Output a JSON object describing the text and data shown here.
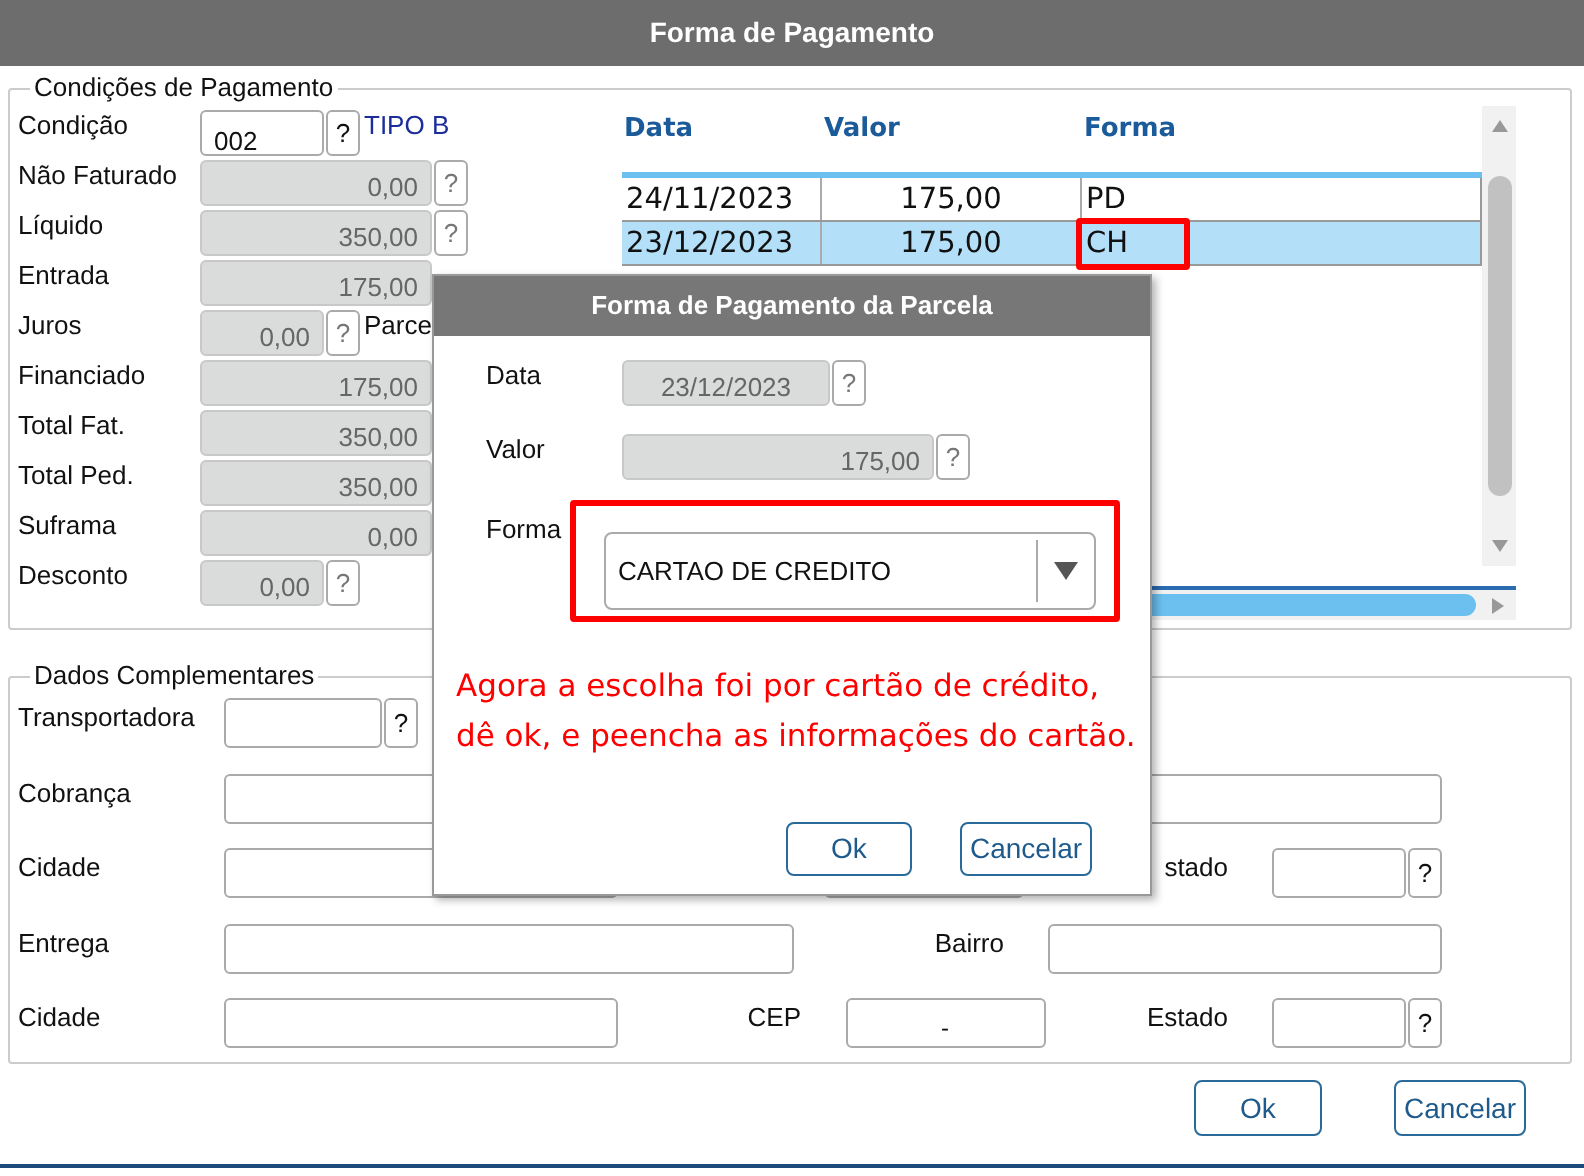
{
  "window": {
    "title": "Forma de Pagamento"
  },
  "conditions": {
    "legend": "Condições de Pagamento",
    "fields": [
      {
        "label": "Condição",
        "kind": "code",
        "value": "002",
        "help": "?",
        "note": {
          "text": "TIPO B",
          "kind": "type_name"
        }
      },
      {
        "label": "Não Faturado",
        "kind": "amount",
        "value": "0,00",
        "help": "?"
      },
      {
        "label": "Líquido",
        "kind": "amount",
        "value": "350,00",
        "help": "?"
      },
      {
        "label": "Entrada",
        "kind": "amount",
        "value": "175,00"
      },
      {
        "label": "Juros",
        "kind": "short_amount",
        "value": "0,00",
        "help": "?",
        "note": {
          "text": "Parce",
          "kind": "label"
        }
      },
      {
        "label": "Financiado",
        "kind": "amount",
        "value": "175,00"
      },
      {
        "label": "Total Fat.",
        "kind": "amount",
        "value": "350,00"
      },
      {
        "label": "Total Ped.",
        "kind": "amount",
        "value": "350,00"
      },
      {
        "label": "Suframa",
        "kind": "amount",
        "value": "0,00"
      },
      {
        "label": "Desconto",
        "kind": "short_amount",
        "value": "0,00",
        "help": "?"
      }
    ]
  },
  "installments": {
    "columns": [
      "Data",
      "Valor",
      "Forma"
    ],
    "rows": [
      {
        "selected": false,
        "cells": [
          {
            "text": "24/11/2023",
            "highlighted": false
          },
          {
            "text": "175,00",
            "highlighted": false
          },
          {
            "text": "PD",
            "highlighted": false
          }
        ]
      },
      {
        "selected": true,
        "cells": [
          {
            "text": "23/12/2023",
            "highlighted": false
          },
          {
            "text": "175,00",
            "highlighted": false
          },
          {
            "text": "CH",
            "highlighted": true
          }
        ]
      }
    ]
  },
  "complementary": {
    "legend": "Dados Complementares",
    "rows": [
      {
        "items": [
          {
            "kind": "label",
            "text": "Transportadora"
          },
          {
            "kind": "short_field"
          },
          {
            "kind": "help",
            "text": "?"
          }
        ]
      },
      {
        "items": [
          {
            "kind": "label",
            "text": "Cobrança"
          },
          {
            "kind": "address_field"
          }
        ]
      },
      {
        "items": [
          {
            "kind": "label",
            "text": "Cidade"
          },
          {
            "kind": "city_field"
          },
          {
            "kind": "gap"
          },
          {
            "kind": "zip_field"
          },
          {
            "kind": "mid_label",
            "text": "stado"
          },
          {
            "kind": "state_field"
          },
          {
            "kind": "help",
            "text": "?"
          }
        ]
      },
      {
        "items": [
          {
            "kind": "label",
            "text": "Entrega"
          },
          {
            "kind": "street_field"
          },
          {
            "kind": "mid_label",
            "text": "Bairro"
          },
          {
            "kind": "district_field"
          }
        ]
      },
      {
        "items": [
          {
            "kind": "label",
            "text": "Cidade"
          },
          {
            "kind": "city_field"
          },
          {
            "kind": "mid_label",
            "text": "CEP"
          },
          {
            "kind": "zip_field",
            "value": "-"
          },
          {
            "kind": "mid_label",
            "text": "Estado"
          },
          {
            "kind": "state_field"
          },
          {
            "kind": "help",
            "text": "?"
          }
        ]
      }
    ]
  },
  "buttons": [
    "Ok",
    "Cancelar"
  ],
  "dialog": {
    "title": "Forma de Pagamento da Parcela",
    "fields": [
      {
        "label": "Data",
        "kind": "date",
        "value": "23/12/2023",
        "help": "?"
      },
      {
        "label": "Valor",
        "kind": "amount",
        "value": "175,00",
        "help": "?"
      },
      {
        "label": "Forma",
        "kind": "select",
        "value": "CARTAO DE CREDITO",
        "highlighted": true
      }
    ],
    "annotation": "Agora a escolha foi por cartão de crédito,\ndê ok, e peencha as informações do cartão.",
    "buttons": [
      "Ok",
      "Cancelar"
    ]
  }
}
